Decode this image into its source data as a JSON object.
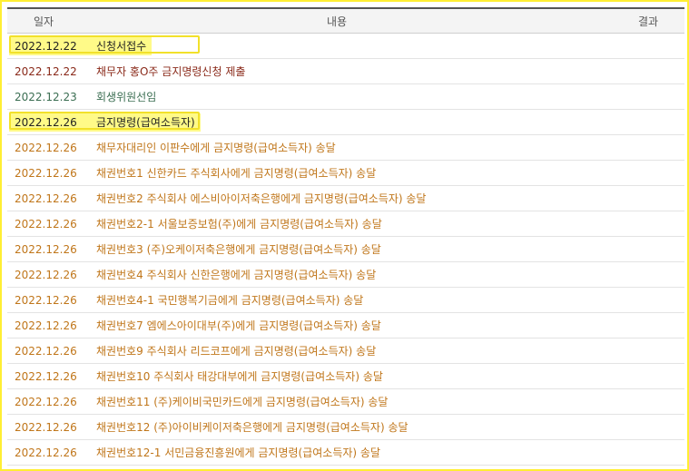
{
  "header": {
    "date": "일자",
    "content": "내용",
    "result": "결과"
  },
  "colors": {
    "black": "#222222",
    "darkred": "#8a2a1a",
    "green": "#3b6e52",
    "orange": "#c0761a",
    "highlight": "#fffa88"
  },
  "rows": [
    {
      "date": "2022.12.22",
      "content": "신청서접수",
      "tone": "black",
      "hl": true
    },
    {
      "date": "2022.12.22",
      "content": "채무자 홍O주 금지명령신청 제출",
      "tone": "darkred",
      "hl": false
    },
    {
      "date": "2022.12.23",
      "content": "회생위원선임",
      "tone": "green",
      "hl": false
    },
    {
      "date": "2022.12.26",
      "content": "금지명령(급여소득자)",
      "tone": "black",
      "hl": true
    },
    {
      "date": "2022.12.26",
      "content": "채무자대리인 이판수에게 금지명령(급여소득자) 송달",
      "tone": "orange",
      "hl": false
    },
    {
      "date": "2022.12.26",
      "content": "채권번호1 신한카드 주식회사에게 금지명령(급여소득자) 송달",
      "tone": "orange",
      "hl": false
    },
    {
      "date": "2022.12.26",
      "content": "채권번호2 주식회사 에스비아이저축은행에게 금지명령(급여소득자) 송달",
      "tone": "orange",
      "hl": false
    },
    {
      "date": "2022.12.26",
      "content": "채권번호2-1 서울보증보험(주)에게 금지명령(급여소득자) 송달",
      "tone": "orange",
      "hl": false
    },
    {
      "date": "2022.12.26",
      "content": "채권번호3 (주)오케이저축은행에게 금지명령(급여소득자) 송달",
      "tone": "orange",
      "hl": false
    },
    {
      "date": "2022.12.26",
      "content": "채권번호4 주식회사 신한은행에게 금지명령(급여소득자) 송달",
      "tone": "orange",
      "hl": false
    },
    {
      "date": "2022.12.26",
      "content": "채권번호4-1 국민행복기금에게 금지명령(급여소득자) 송달",
      "tone": "orange",
      "hl": false
    },
    {
      "date": "2022.12.26",
      "content": "채권번호7 엠에스아이대부(주)에게 금지명령(급여소득자) 송달",
      "tone": "orange",
      "hl": false
    },
    {
      "date": "2022.12.26",
      "content": "채권번호9 주식회사 리드코프에게 금지명령(급여소득자) 송달",
      "tone": "orange",
      "hl": false
    },
    {
      "date": "2022.12.26",
      "content": "채권번호10 주식회사 태강대부에게 금지명령(급여소득자) 송달",
      "tone": "orange",
      "hl": false
    },
    {
      "date": "2022.12.26",
      "content": "채권번호11 (주)케이비국민카드에게 금지명령(급여소득자) 송달",
      "tone": "orange",
      "hl": false
    },
    {
      "date": "2022.12.26",
      "content": "채권번호12 (주)아이비케이저축은행에게 금지명령(급여소득자) 송달",
      "tone": "orange",
      "hl": false
    },
    {
      "date": "2022.12.26",
      "content": "채권번호12-1 서민금융진흥원에게 금지명령(급여소득자) 송달",
      "tone": "orange",
      "hl": false
    }
  ]
}
